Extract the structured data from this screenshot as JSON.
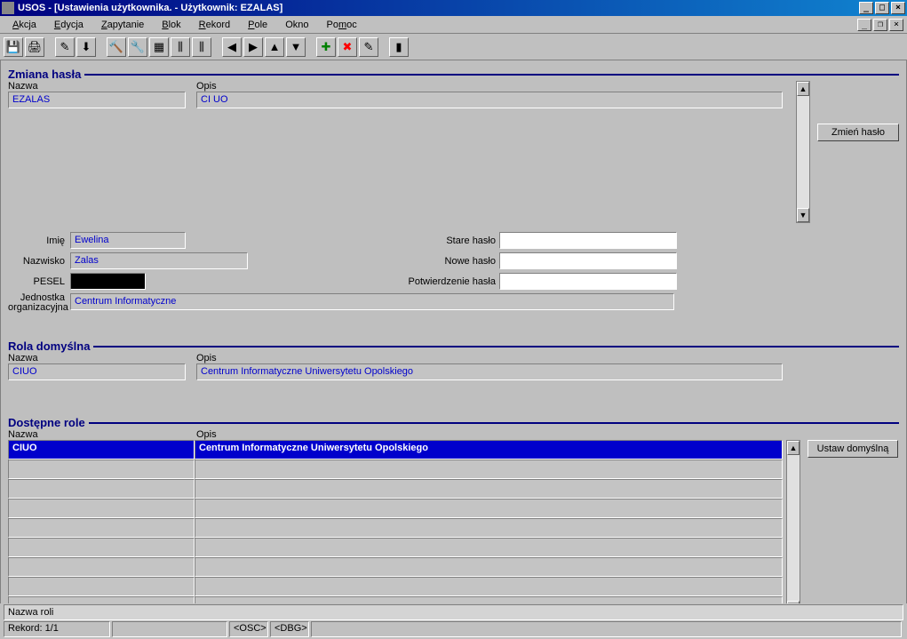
{
  "window": {
    "title": "USOS - [Ustawienia użytkownika. - Użytkownik: EZALAS]"
  },
  "menu": {
    "items": [
      "Akcja",
      "Edycja",
      "Zapytanie",
      "Blok",
      "Rekord",
      "Pole",
      "Okno",
      "Pomoc"
    ]
  },
  "section_zmiana": {
    "title": "Zmiana hasła",
    "nazwa_label": "Nazwa",
    "opis_label": "Opis",
    "nazwa": "EZALAS",
    "opis": "CI UO",
    "imie_label": "Imię",
    "imie": "Ewelina",
    "nazwisko_label": "Nazwisko",
    "nazwisko": "Zalas",
    "pesel_label": "PESEL",
    "pesel": "",
    "jednostka_label": "Jednostka organizacyjna",
    "jednostka": "Centrum Informatyczne",
    "stare_label": "Stare hasło",
    "nowe_label": "Nowe hasło",
    "potw_label": "Potwierdzenie hasła",
    "button": "Zmień hasło"
  },
  "section_rola": {
    "title": "Rola domyślna",
    "nazwa_label": "Nazwa",
    "opis_label": "Opis",
    "nazwa": "CIUO",
    "opis": "Centrum Informatyczne Uniwersytetu Opolskiego"
  },
  "section_dostepne": {
    "title": "Dostępne role",
    "nazwa_label": "Nazwa",
    "opis_label": "Opis",
    "button": "Ustaw domyślną",
    "rows": [
      {
        "nazwa": "CIUO",
        "opis": "Centrum Informatyczne Uniwersytetu Opolskiego"
      }
    ]
  },
  "status": {
    "line1": "Nazwa roli",
    "rekord": "Rekord: 1/1",
    "osc": "<OSC>",
    "dbg": "<DBG>"
  }
}
